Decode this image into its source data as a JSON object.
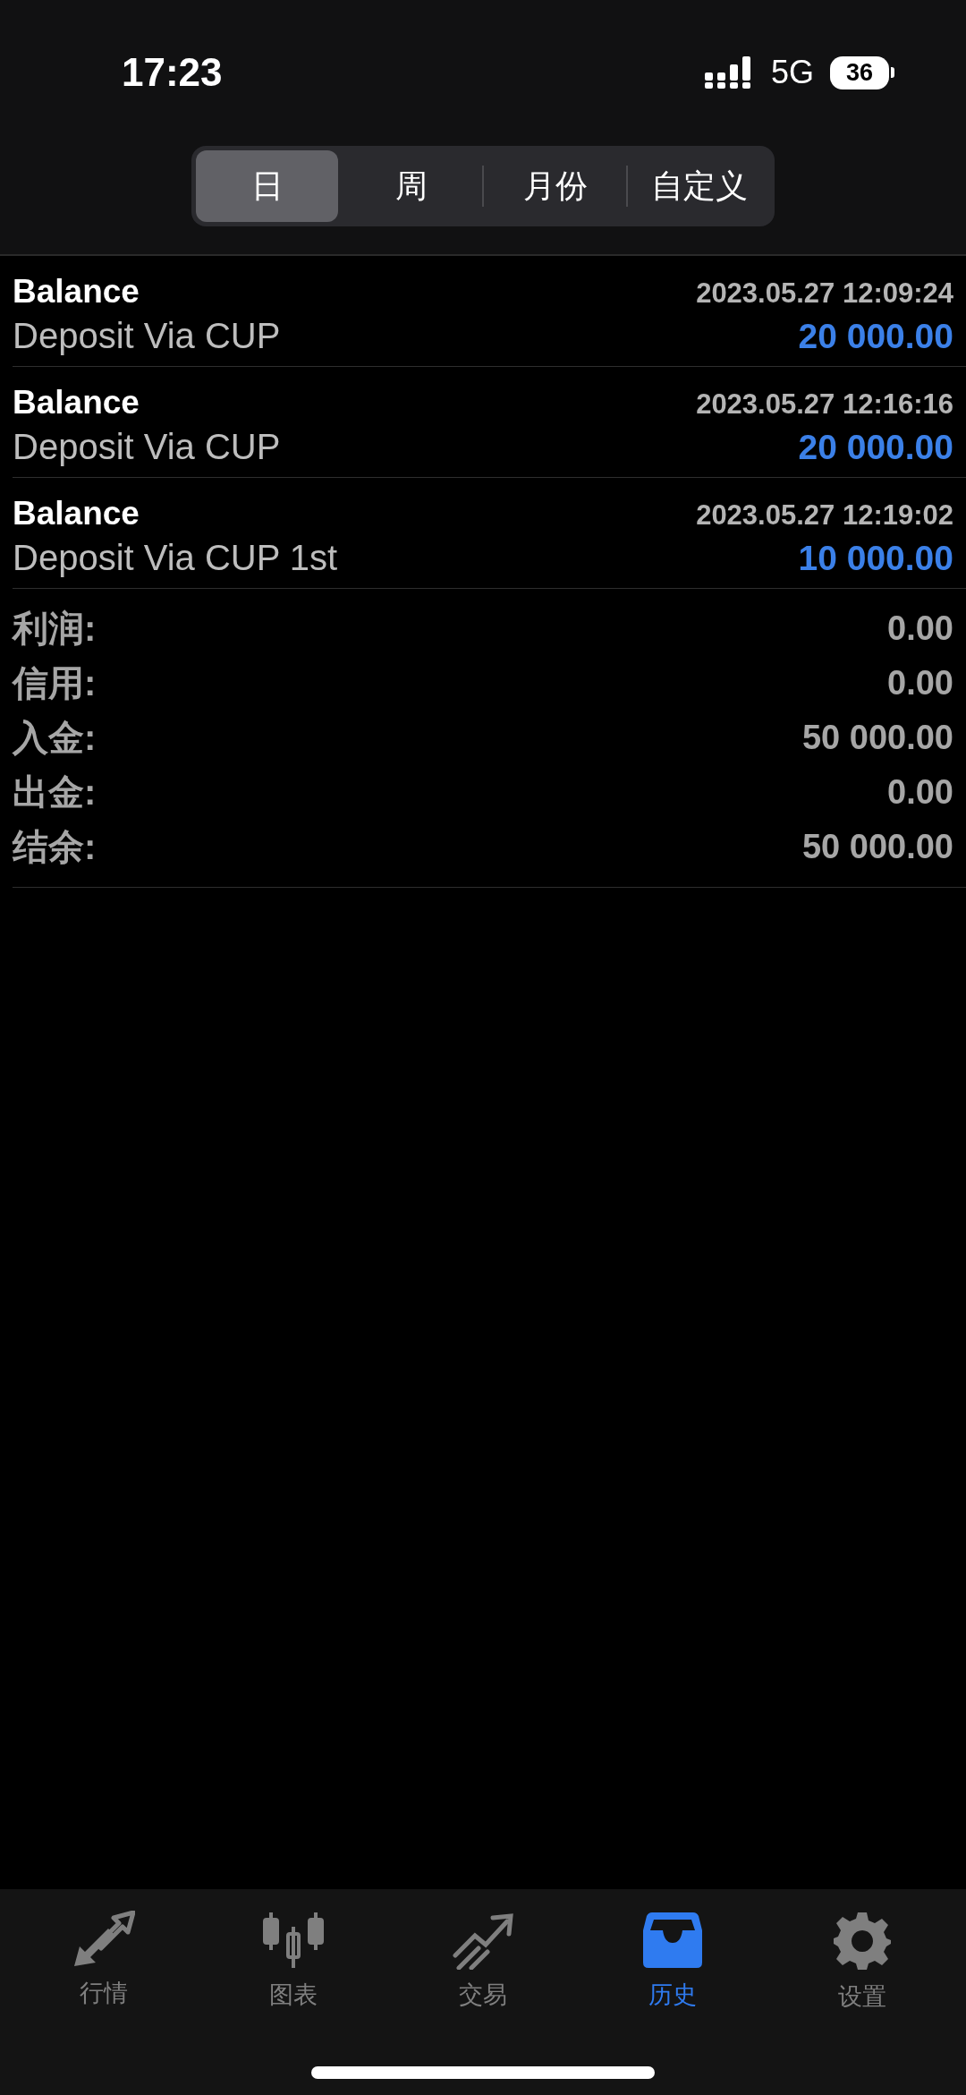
{
  "status_bar": {
    "time": "17:23",
    "network": "5G",
    "battery": "36"
  },
  "period_tabs": [
    {
      "label": "日",
      "selected": true
    },
    {
      "label": "周",
      "selected": false
    },
    {
      "label": "月份",
      "selected": false
    },
    {
      "label": "自定义",
      "selected": false
    }
  ],
  "deals": [
    {
      "type": "Balance",
      "time": "2023.05.27 12:09:24",
      "comment": "Deposit Via CUP",
      "amount": "20 000.00"
    },
    {
      "type": "Balance",
      "time": "2023.05.27 12:16:16",
      "comment": "Deposit Via CUP",
      "amount": "20 000.00"
    },
    {
      "type": "Balance",
      "time": "2023.05.27 12:19:02",
      "comment": "Deposit Via CUP 1st",
      "amount": "10 000.00"
    }
  ],
  "summary": [
    {
      "label": "利润:",
      "value": "0.00"
    },
    {
      "label": "信用:",
      "value": "0.00"
    },
    {
      "label": "入金:",
      "value": "50 000.00"
    },
    {
      "label": "出金:",
      "value": "0.00"
    },
    {
      "label": "结余:",
      "value": "50 000.00"
    }
  ],
  "tab_bar": [
    {
      "kind": "quotes",
      "label": "行情",
      "selected": false
    },
    {
      "kind": "chart",
      "label": "图表",
      "selected": false
    },
    {
      "kind": "trade",
      "label": "交易",
      "selected": false
    },
    {
      "kind": "history",
      "label": "历史",
      "selected": true
    },
    {
      "kind": "settings",
      "label": "设置",
      "selected": false
    }
  ]
}
